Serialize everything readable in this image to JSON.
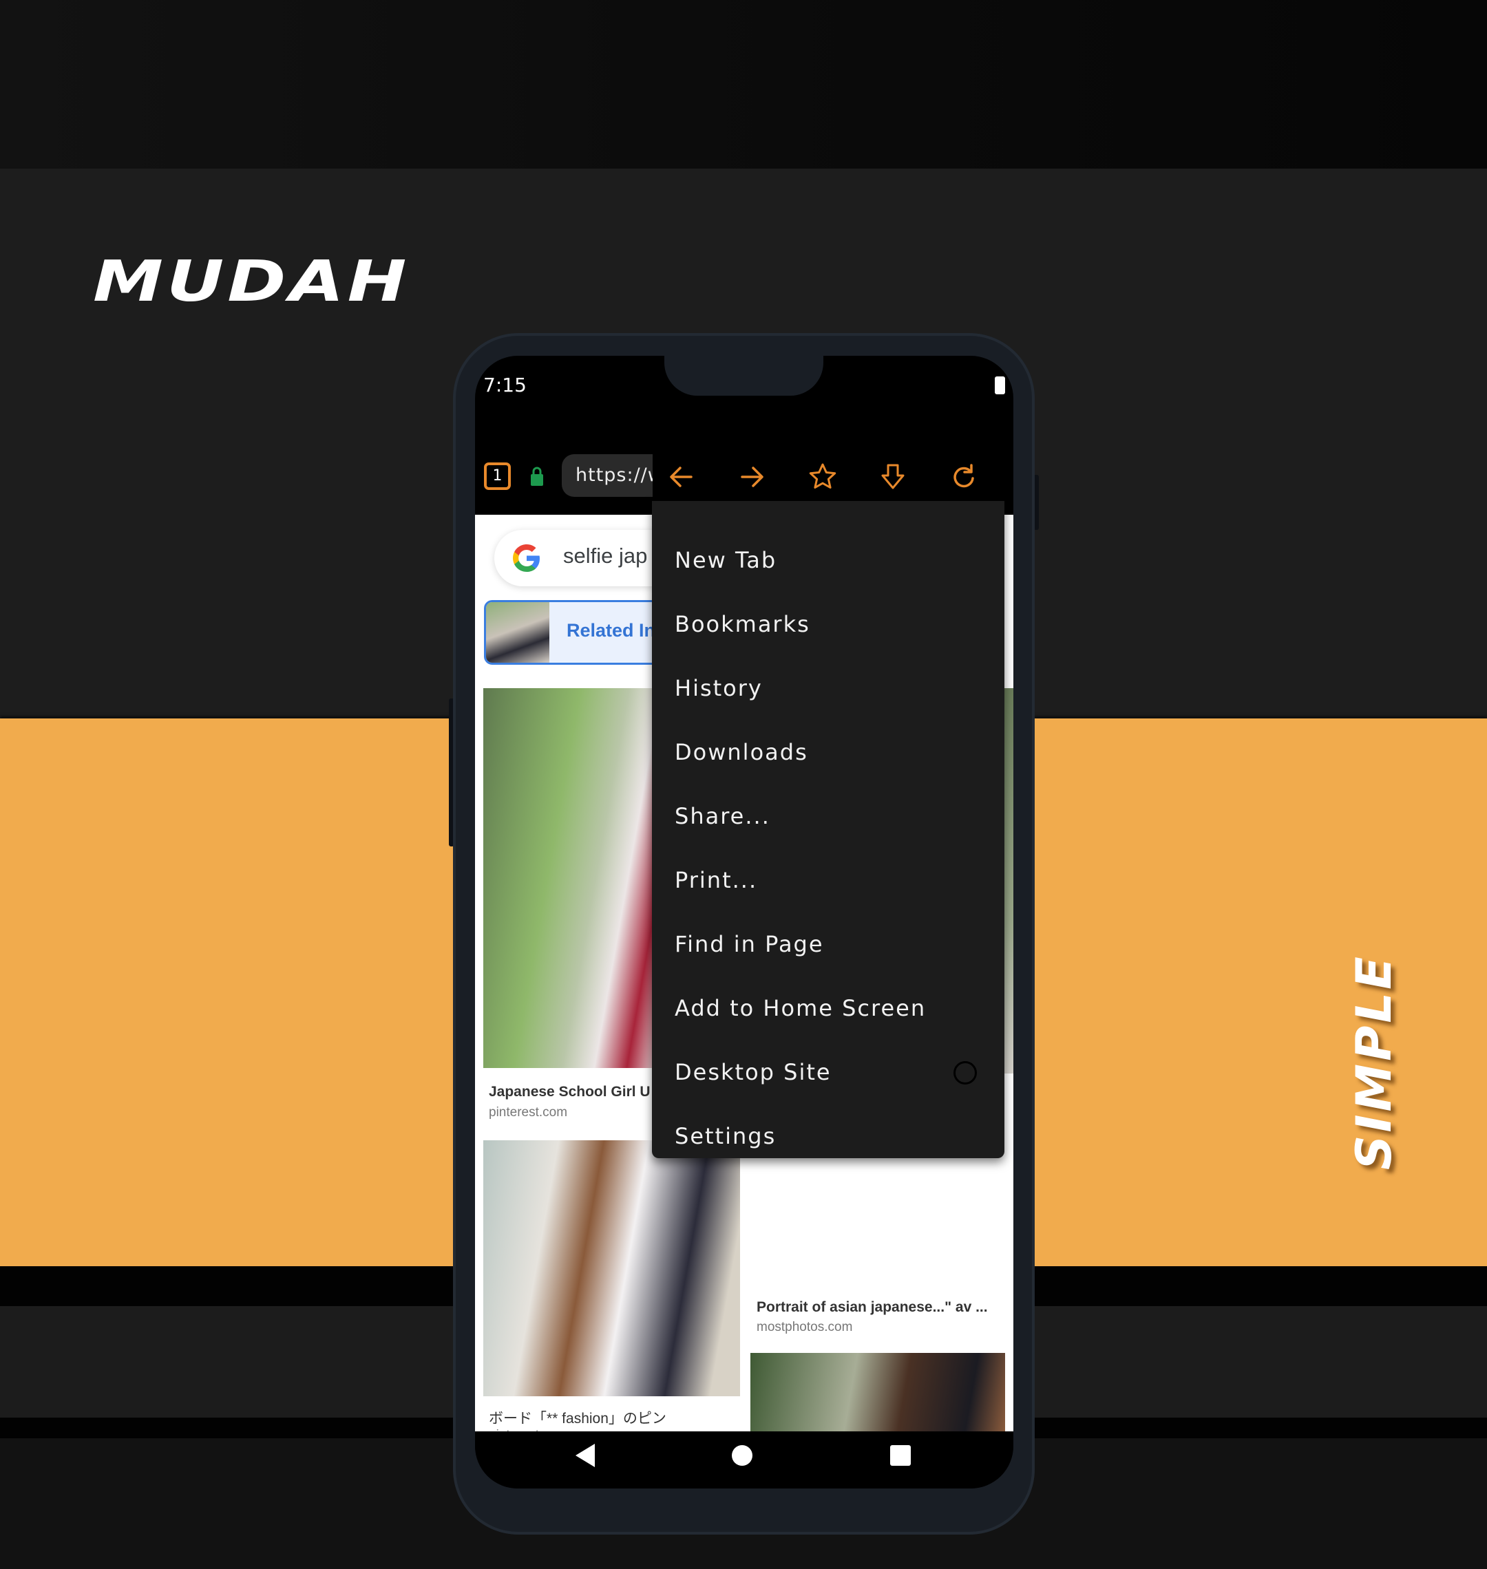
{
  "brand": {
    "title": "MUDAH",
    "tagline": "SIMPLE"
  },
  "status_bar": {
    "time": "7:15",
    "battery_icon": "battery-icon"
  },
  "browser": {
    "tab_count": "1",
    "url": "https://w",
    "lock_icon": "lock-icon",
    "toolbar_icons": [
      "back-arrow-icon",
      "forward-arrow-icon",
      "star-icon",
      "download-icon",
      "reload-icon"
    ],
    "accent_color": "#e8892b"
  },
  "page": {
    "search_query": "selfie jap",
    "related_label": "Related In",
    "results": [
      {
        "caption": "Japanese School Girl U",
        "source": "pinterest.com"
      },
      {
        "caption": "Portrait of asian japanese...\" av ...",
        "source": "mostphotos.com"
      },
      {
        "caption": "ボード「** fashion」のピン",
        "source": "pinterest.com"
      }
    ]
  },
  "menu": {
    "items": [
      {
        "label": "New Tab"
      },
      {
        "label": "Bookmarks"
      },
      {
        "label": "History"
      },
      {
        "label": "Downloads"
      },
      {
        "label": "Share..."
      },
      {
        "label": "Print..."
      },
      {
        "label": "Find in Page"
      },
      {
        "label": "Add to Home Screen"
      },
      {
        "label": "Desktop Site",
        "toggle": false
      },
      {
        "label": "Settings"
      }
    ]
  },
  "nav": {
    "back": "back-icon",
    "home": "home-icon",
    "recents": "recents-icon"
  },
  "colors": {
    "orange_band": "#f1ab4d",
    "menu_bg": "#1c1c1c"
  }
}
